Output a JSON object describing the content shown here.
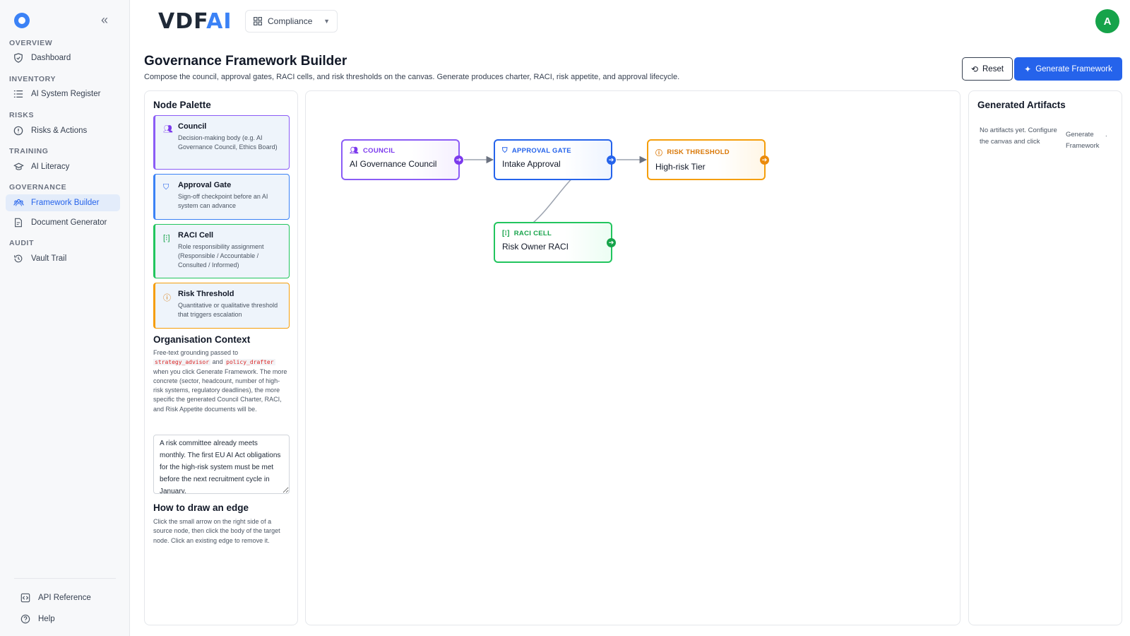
{
  "app": {
    "brand_left": "VDF",
    "brand_right": "AI"
  },
  "workspace": {
    "label": "Compliance"
  },
  "user": {
    "avatar_initial": "A"
  },
  "sidebar": {
    "sections": [
      {
        "title": "OVERVIEW",
        "items": [
          {
            "label": "Dashboard",
            "icon": "shield-icon"
          }
        ]
      },
      {
        "title": "INVENTORY",
        "items": [
          {
            "label": "AI System Register",
            "icon": "list-icon"
          }
        ]
      },
      {
        "title": "RISKS",
        "items": [
          {
            "label": "Risks & Actions",
            "icon": "alert-circle-icon"
          }
        ]
      },
      {
        "title": "TRAINING",
        "items": [
          {
            "label": "AI Literacy",
            "icon": "graduation-cap-icon"
          }
        ]
      },
      {
        "title": "GOVERNANCE",
        "items": [
          {
            "label": "Framework Builder",
            "icon": "users-icon",
            "active": true
          },
          {
            "label": "Document Generator",
            "icon": "document-icon"
          }
        ]
      },
      {
        "title": "AUDIT",
        "items": [
          {
            "label": "Vault Trail",
            "icon": "history-icon"
          }
        ]
      }
    ],
    "footer": [
      {
        "label": "API Reference",
        "icon": "code-icon"
      },
      {
        "label": "Help",
        "icon": "help-icon"
      }
    ]
  },
  "page": {
    "title": "Governance Framework Builder",
    "subtitle": "Compose the council, approval gates, RACI cells, and risk thresholds on the canvas. Generate produces charter, RACI, risk appetite, and approval lifecycle.",
    "reset_label": "Reset",
    "generate_label": "Generate Framework"
  },
  "palette": {
    "title": "Node Palette",
    "items": [
      {
        "title": "Council",
        "desc": "Decision-making body (e.g. AI Governance Council, Ethics Board)"
      },
      {
        "title": "Approval Gate",
        "desc": "Sign-off checkpoint before an AI system can advance"
      },
      {
        "title": "RACI Cell",
        "desc": "Role responsibility assignment (Responsible / Accountable / Consulted / Informed)"
      },
      {
        "title": "Risk Threshold",
        "desc": "Quantitative or qualitative threshold that triggers escalation"
      }
    ]
  },
  "context": {
    "title": "Organisation Context",
    "desc_before": "Free-text grounding passed to",
    "code1": "strategy_advisor",
    "and": "and",
    "code2": "policy_drafter",
    "desc_after": "when you click Generate Framework. The more concrete (sector, headcount, number of high-risk systems, regulatory deadlines), the more specific the generated Council Charter, RACI, and Risk Appetite documents will be.",
    "value": "A risk committee already meets monthly. The first EU AI Act obligations for the high-risk system must be met before the next recruitment cycle in January."
  },
  "howto": {
    "title": "How to draw an edge",
    "text": "Click the small arrow on the right side of a source node, then click the body of the target node. Click an existing edge to remove it."
  },
  "canvas": {
    "nodes": [
      {
        "type": "COUNCIL",
        "name": "AI Governance Council"
      },
      {
        "type": "APPROVAL GATE",
        "name": "Intake Approval"
      },
      {
        "type": "RISK THRESHOLD",
        "name": "High-risk Tier"
      },
      {
        "type": "RACI CELL",
        "name": "Risk Owner RACI"
      }
    ]
  },
  "artifacts": {
    "title": "Generated Artifacts",
    "empty_part1": "No artifacts yet. Configure the canvas and click",
    "empty_part2": "Generate Framework",
    "empty_part3": "."
  },
  "colors": {
    "accent": "#2563eb",
    "council": "#7c3aed",
    "gate": "#2563eb",
    "raci": "#16a34a",
    "risk": "#d97706"
  }
}
